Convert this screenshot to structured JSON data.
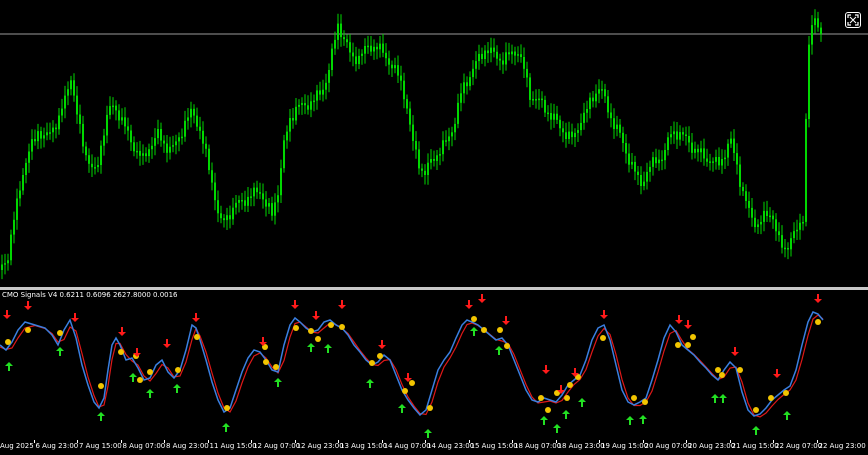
{
  "colors": {
    "background": "#000000",
    "candles": "#00d800",
    "price_line": "#9a9a9a",
    "fast_line": "#3a7fe0",
    "slow_line": "#e01818",
    "signal_dot": "#f2c500",
    "arrow_sell": "#ff1a1a",
    "arrow_buy": "#22e022",
    "text": "#ffffff"
  },
  "indicator": {
    "label": "CMO Signals V4 0.6211 0.6096 2627.8000 0.0016",
    "sell_arrow_icon": "arrow-down-icon",
    "buy_arrow_icon": "arrow-up-icon"
  },
  "toolbar": {
    "fullscreen_icon": "fullscreen-icon"
  },
  "time_axis": {
    "labels": [
      "Aug 2025",
      "6 Aug 23:00",
      "7 Aug 15:00",
      "8 Aug 07:00",
      "8 Aug 23:00",
      "11 Aug 15:00",
      "12 Aug 07:00",
      "12 Aug 23:00",
      "13 Aug 15:00",
      "14 Aug 07:00",
      "14 Aug 23:00",
      "15 Aug 15:00",
      "18 Aug 07:00",
      "18 Aug 23:00",
      "19 Aug 15:00",
      "20 Aug 07:00",
      "20 Aug 23:00",
      "21 Aug 15:00",
      "22 Aug 07:00",
      "22 Aug 23:00"
    ]
  }
}
